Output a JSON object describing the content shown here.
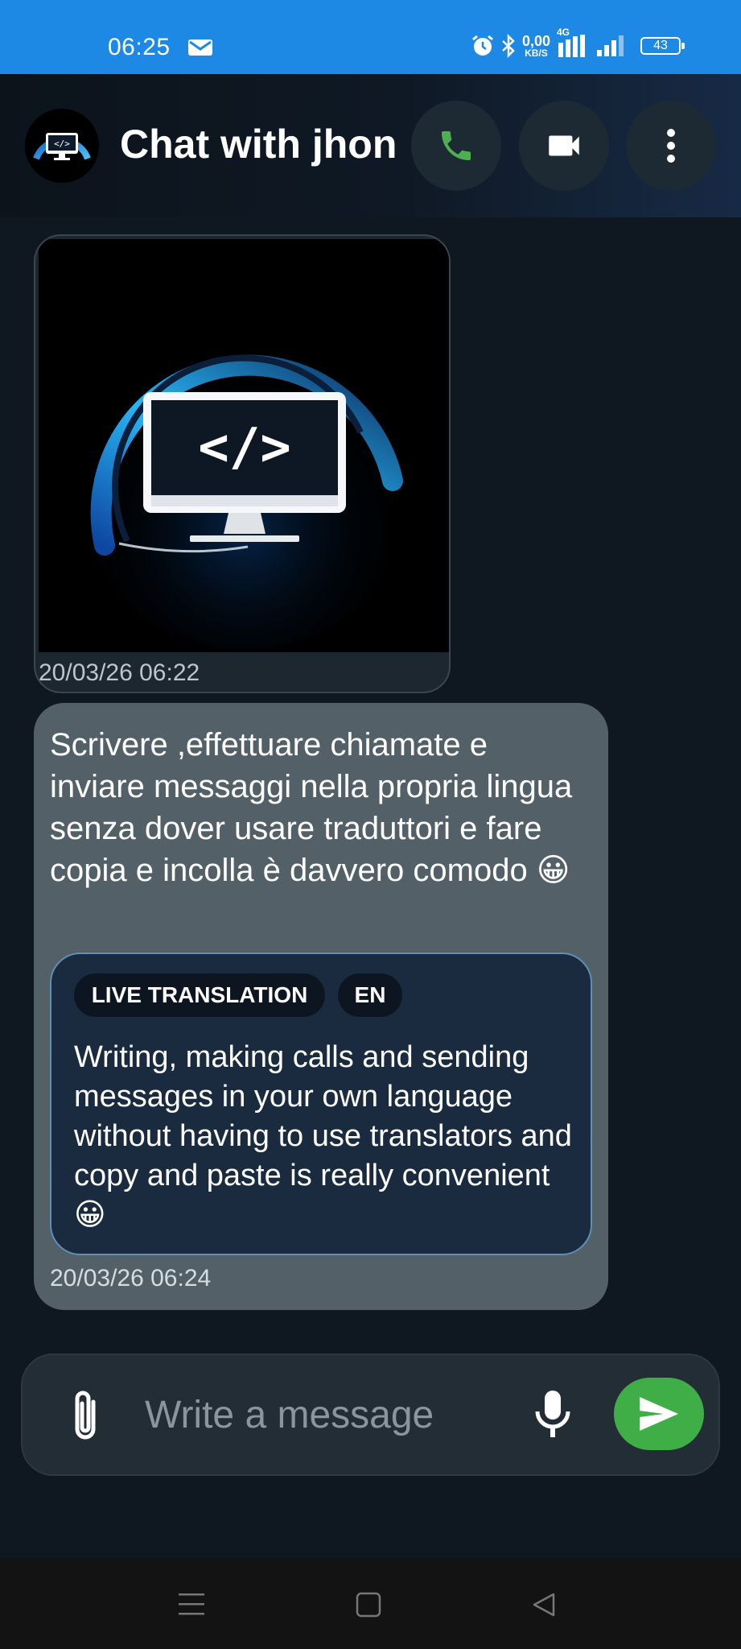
{
  "status_bar": {
    "time": "06:25",
    "speed_value": "0,00",
    "speed_unit": "KB/S",
    "network": "4G",
    "battery": "43"
  },
  "header": {
    "title": "Chat with jhon",
    "icons": [
      "call-icon",
      "video-icon",
      "more-vert-icon"
    ]
  },
  "messages": [
    {
      "type": "image",
      "timestamp": "20/03/26 06:22"
    },
    {
      "type": "text",
      "text": "Scrivere ,effettuare chiamate e inviare messaggi nella propria lingua senza dover usare traduttori e fare copia e incolla è davvero comodo 😀",
      "translation_badge": "LIVE TRANSLATION",
      "language_badge": "EN",
      "translation": "Writing, making calls and sending messages in your own language without having to use translators and copy and paste is really convenient 😀",
      "timestamp": "20/03/26 06:24"
    }
  ],
  "composer": {
    "placeholder": "Write a message"
  },
  "colors": {
    "status_bar": "#1e88e5",
    "send_button": "#3fae47",
    "call_icon": "#4caf50",
    "bubble": "#546068",
    "translation_box": "#1a2a3f"
  }
}
